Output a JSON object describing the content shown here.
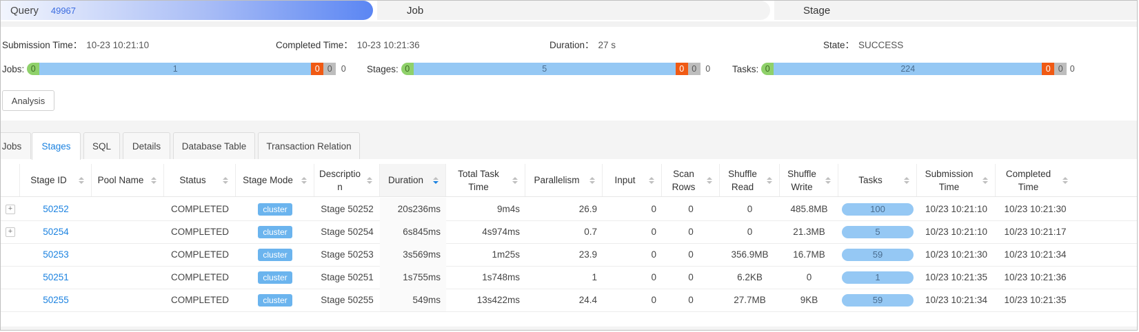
{
  "steps": {
    "query_label": "Query",
    "query_id": "49967",
    "job_label": "Job",
    "stage_label": "Stage"
  },
  "info": {
    "submission_label": "Submission Time：",
    "submission_value": "10-23 10:21:10",
    "completed_label": "Completed Time：",
    "completed_value": "10-23 10:21:36",
    "duration_label": "Duration：",
    "duration_value": "27 s",
    "state_label": "State：",
    "state_value": "SUCCESS"
  },
  "progress": {
    "jobs": {
      "label": "Jobs:",
      "succeeded": "0",
      "running": "1",
      "failed": "0",
      "killed": "0",
      "pending": "0"
    },
    "stages": {
      "label": "Stages:",
      "succeeded": "0",
      "running": "5",
      "failed": "0",
      "killed": "0",
      "pending": "0"
    },
    "tasks": {
      "label": "Tasks:",
      "succeeded": "0",
      "running": "224",
      "failed": "0",
      "killed": "0",
      "pending": "0"
    }
  },
  "analysis_button": "Analysis",
  "tabs": [
    "Jobs",
    "Stages",
    "SQL",
    "Details",
    "Database Table",
    "Transaction Relation"
  ],
  "active_tab": "Stages",
  "table": {
    "headers": {
      "stage_id": "Stage ID",
      "pool_name": "Pool Name",
      "status": "Status",
      "stage_mode": "Stage Mode",
      "description_1": "Descriptio",
      "description_2": "n",
      "duration": "Duration",
      "total_task_time_1": "Total Task",
      "total_task_time_2": "Time",
      "parallelism": "Parallelism",
      "input": "Input",
      "scan_rows_1": "Scan",
      "scan_rows_2": "Rows",
      "shuffle_read_1": "Shuffle",
      "shuffle_read_2": "Read",
      "shuffle_write_1": "Shuffle",
      "shuffle_write_2": "Write",
      "tasks": "Tasks",
      "submission_time_1": "Submission",
      "submission_time_2": "Time",
      "completed_time_1": "Completed",
      "completed_time_2": "Time"
    },
    "rows": [
      {
        "expand": "+",
        "stage_id": "50252",
        "pool_name": "",
        "status": "COMPLETED",
        "mode": "cluster",
        "description": "Stage 50252",
        "duration": "20s236ms",
        "total_task_time": "9m4s",
        "parallelism": "26.9",
        "input": "0",
        "scan_rows": "0",
        "shuffle_read": "0",
        "shuffle_write": "485.8MB",
        "tasks": "100",
        "submission_time": "10/23 10:21:10",
        "completed_time": "10/23 10:21:30"
      },
      {
        "expand": "+",
        "stage_id": "50254",
        "pool_name": "",
        "status": "COMPLETED",
        "mode": "cluster",
        "description": "Stage 50254",
        "duration": "6s845ms",
        "total_task_time": "4s974ms",
        "parallelism": "0.7",
        "input": "0",
        "scan_rows": "0",
        "shuffle_read": "0",
        "shuffle_write": "21.3MB",
        "tasks": "5",
        "submission_time": "10/23 10:21:10",
        "completed_time": "10/23 10:21:17"
      },
      {
        "expand": "",
        "stage_id": "50253",
        "pool_name": "",
        "status": "COMPLETED",
        "mode": "cluster",
        "description": "Stage 50253",
        "duration": "3s569ms",
        "total_task_time": "1m25s",
        "parallelism": "23.9",
        "input": "0",
        "scan_rows": "0",
        "shuffle_read": "356.9MB",
        "shuffle_write": "16.7MB",
        "tasks": "59",
        "submission_time": "10/23 10:21:30",
        "completed_time": "10/23 10:21:34"
      },
      {
        "expand": "",
        "stage_id": "50251",
        "pool_name": "",
        "status": "COMPLETED",
        "mode": "cluster",
        "description": "Stage 50251",
        "duration": "1s755ms",
        "total_task_time": "1s748ms",
        "parallelism": "1",
        "input": "0",
        "scan_rows": "0",
        "shuffle_read": "6.2KB",
        "shuffle_write": "0",
        "tasks": "1",
        "submission_time": "10/23 10:21:35",
        "completed_time": "10/23 10:21:36"
      },
      {
        "expand": "",
        "stage_id": "50255",
        "pool_name": "",
        "status": "COMPLETED",
        "mode": "cluster",
        "description": "Stage 50255",
        "duration": "549ms",
        "total_task_time": "13s422ms",
        "parallelism": "24.4",
        "input": "0",
        "scan_rows": "0",
        "shuffle_read": "27.7MB",
        "shuffle_write": "9KB",
        "tasks": "59",
        "submission_time": "10/23 10:21:34",
        "completed_time": "10/23 10:21:35"
      }
    ]
  },
  "colors": {
    "accent": "#1b82e0",
    "succeeded": "#8fd16a",
    "running": "#95c8f4",
    "failed": "#f05a14",
    "killed": "#bdbdbd",
    "tag": "#6bb4ee"
  },
  "icons": [
    "sort-icon",
    "sort-desc-icon",
    "expand-icon"
  ]
}
